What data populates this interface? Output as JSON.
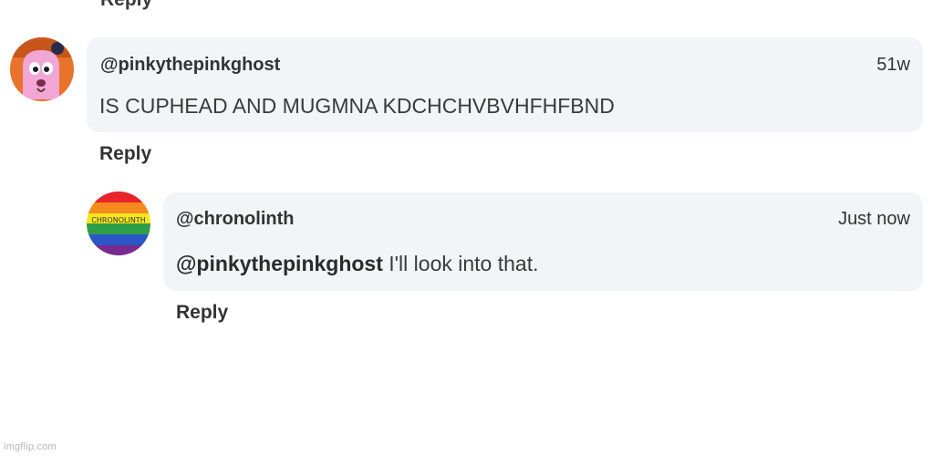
{
  "top": {
    "reply_label": "Reply"
  },
  "comments": [
    {
      "username": "@pinkythepinkghost",
      "time": "51w",
      "text": "IS CUPHEAD AND MUGMNA KDCHCHVBVHFHFBND",
      "reply_label": "Reply"
    },
    {
      "username": "@chronolinth",
      "time": "Just now",
      "mention": "@pinkythepinkghost",
      "text": " I'll look into that.",
      "avatar_text": "CHRONOLINTH",
      "reply_label": "Reply"
    }
  ],
  "watermark": "imgflip.com",
  "colors": {
    "bubble": "#f3f4f7",
    "avatar1_bg": "#e8732a",
    "avatar1_ghost": "#f2a6d6",
    "rainbow": [
      "#e8232b",
      "#f58a1f",
      "#f6e51b",
      "#2e9e48",
      "#2a56c6",
      "#7a2a8f"
    ]
  }
}
